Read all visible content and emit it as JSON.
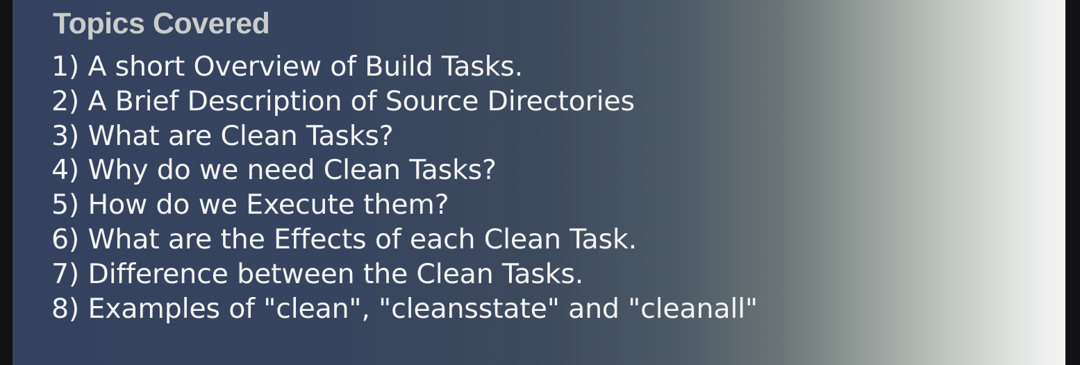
{
  "slide": {
    "title": "Topics Covered",
    "topics": [
      "1) A short Overview of Build Tasks.",
      "2) A Brief Description of Source Directories",
      "3) What are Clean Tasks?",
      "4) Why do we need Clean Tasks?",
      "5) How do we Execute them?",
      "6) What are the Effects of each Clean Task.",
      "7) Difference between the Clean Tasks.",
      "8) Examples of \"clean\", \"cleansstate\" and \"cleanall\""
    ]
  },
  "colors": {
    "slide_left": "#34425f",
    "slide_right": "#f3f3f2",
    "title_text": "#c9ccca",
    "body_text": "#f4f4f4",
    "frame": "#111113"
  }
}
